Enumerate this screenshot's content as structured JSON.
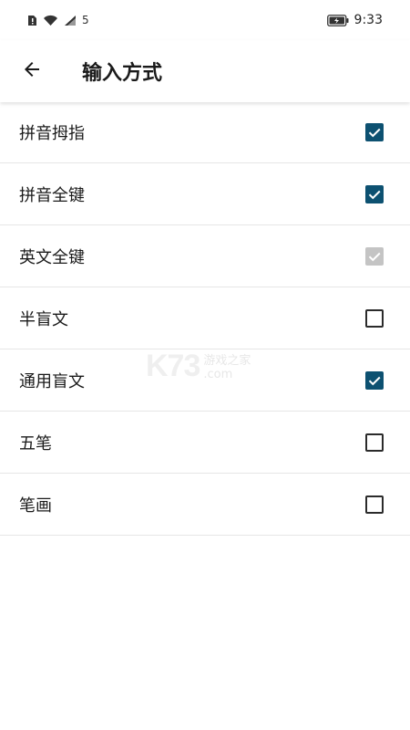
{
  "status_bar": {
    "time": "9:33",
    "network_badge": "5",
    "icons": [
      "sim-alert-icon",
      "wifi-icon",
      "signal-icon",
      "battery-charging-icon"
    ]
  },
  "header": {
    "title": "输入方式",
    "back_icon": "arrow-left-icon"
  },
  "options": [
    {
      "label": "拼音拇指",
      "state": "checked"
    },
    {
      "label": "拼音全键",
      "state": "checked"
    },
    {
      "label": "英文全键",
      "state": "disabled-checked"
    },
    {
      "label": "半盲文",
      "state": "unchecked"
    },
    {
      "label": "通用盲文",
      "state": "checked"
    },
    {
      "label": "五笔",
      "state": "unchecked"
    },
    {
      "label": "笔画",
      "state": "unchecked"
    }
  ],
  "watermark": {
    "logo": "K73",
    "line1": "游戏之家",
    "line2": ".com"
  },
  "colors": {
    "checked": "#0d5171",
    "disabled": "#c4c4c4",
    "border": "#2b2b2b",
    "divider": "#e6e6e6"
  }
}
